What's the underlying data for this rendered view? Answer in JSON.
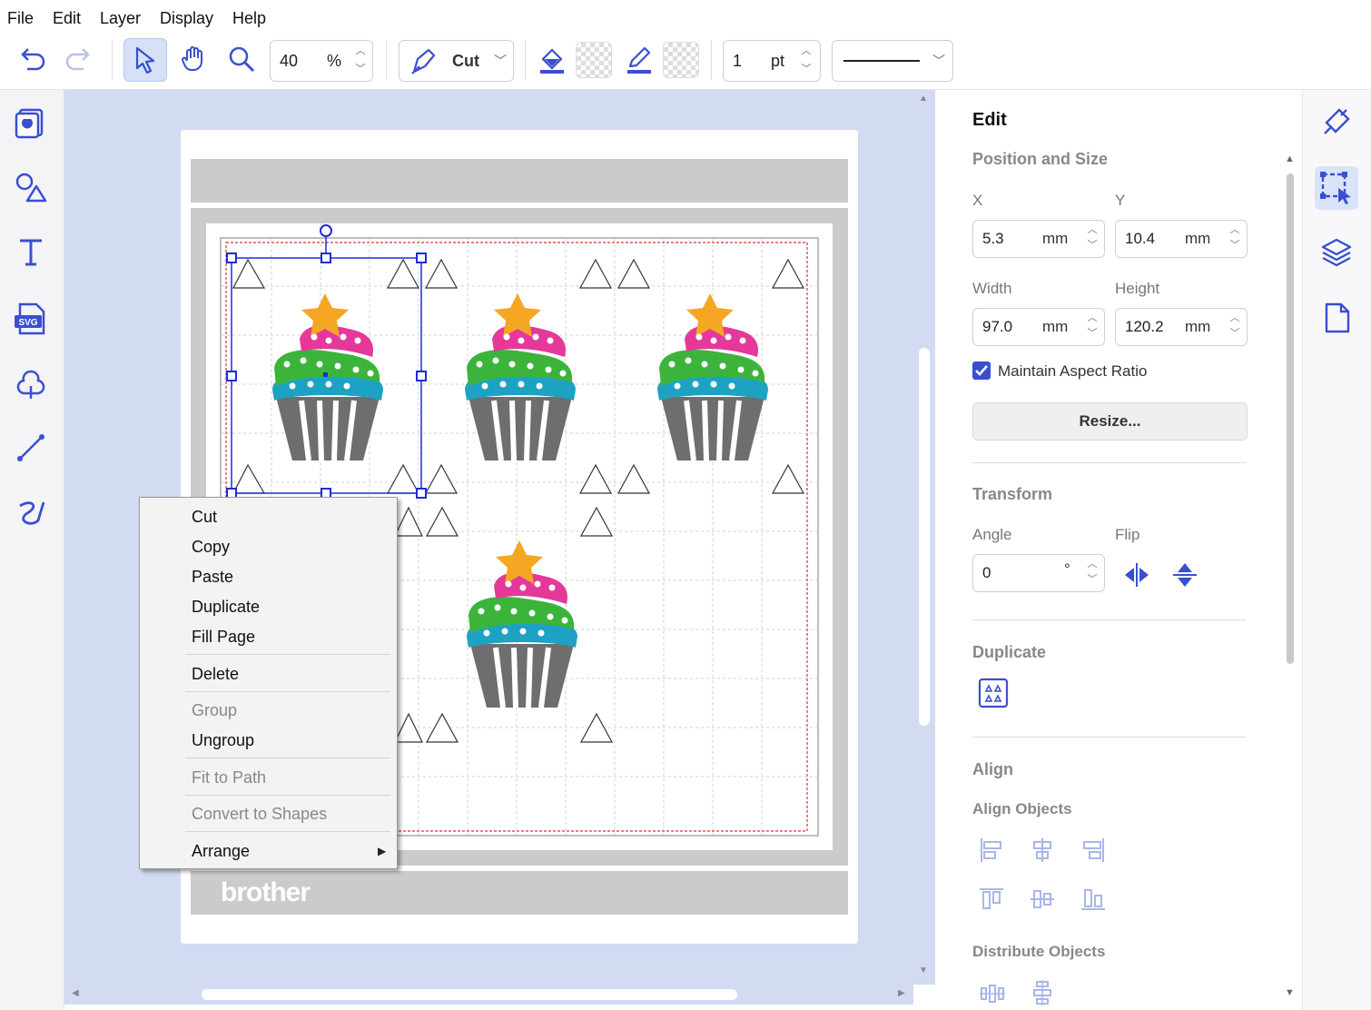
{
  "menu": [
    "File",
    "Edit",
    "Layer",
    "Display",
    "Help"
  ],
  "toolbar": {
    "zoom_value": "40",
    "zoom_unit": "%",
    "mode_label": "Cut",
    "line_width_value": "1",
    "line_width_unit": "pt"
  },
  "canvas": {
    "brand_logo": "brother"
  },
  "edit_panel": {
    "title": "Edit",
    "position_size_heading": "Position and Size",
    "x_label": "X",
    "y_label": "Y",
    "x_value": "5.3",
    "y_value": "10.4",
    "width_label": "Width",
    "height_label": "Height",
    "width_value": "97.0",
    "height_value": "120.2",
    "unit": "mm",
    "maintain_aspect_label": "Maintain Aspect Ratio",
    "maintain_aspect_checked": true,
    "resize_button": "Resize...",
    "transform_heading": "Transform",
    "angle_label": "Angle",
    "angle_value": "0",
    "angle_unit": "°",
    "flip_label": "Flip",
    "duplicate_heading": "Duplicate",
    "align_heading": "Align",
    "align_objects_label": "Align Objects",
    "distribute_objects_label": "Distribute Objects"
  },
  "context_menu": {
    "cut": "Cut",
    "copy": "Copy",
    "paste": "Paste",
    "duplicate": "Duplicate",
    "fill_page": "Fill Page",
    "delete": "Delete",
    "group": "Group",
    "ungroup": "Ungroup",
    "fit_to_path": "Fit to Path",
    "convert_to_shapes": "Convert to Shapes",
    "arrange": "Arrange"
  },
  "colors": {
    "accent": "#3a4fd0",
    "selection": "#1f2bd6",
    "canvas_bg": "#d3dbf2",
    "cupcake_pink": "#e4399a",
    "cupcake_green": "#3cb43c",
    "cupcake_teal": "#1ea2c4",
    "cupcake_star": "#f5a623",
    "cupcake_wrapper": "#6e6e6e"
  }
}
